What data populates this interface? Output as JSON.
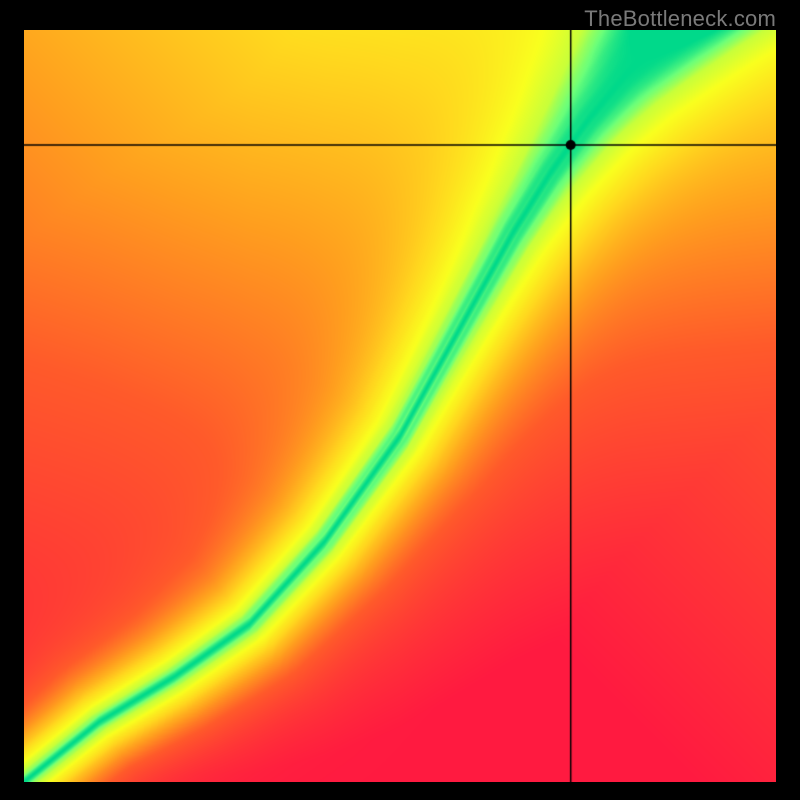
{
  "attribution": "TheBottleneck.com",
  "chart_data": {
    "type": "heatmap",
    "title": "",
    "xlabel": "",
    "ylabel": "",
    "xlim": [
      0,
      1
    ],
    "ylim": [
      0,
      1
    ],
    "crosshair": {
      "x": 0.727,
      "y": 0.847
    },
    "marker": {
      "x": 0.727,
      "y": 0.847
    },
    "ridge_curve": {
      "description": "locus of optimal (green) values, approximate",
      "points": [
        [
          0.0,
          0.0
        ],
        [
          0.1,
          0.08
        ],
        [
          0.2,
          0.14
        ],
        [
          0.3,
          0.21
        ],
        [
          0.4,
          0.32
        ],
        [
          0.5,
          0.46
        ],
        [
          0.55,
          0.55
        ],
        [
          0.6,
          0.64
        ],
        [
          0.65,
          0.73
        ],
        [
          0.7,
          0.81
        ],
        [
          0.75,
          0.88
        ],
        [
          0.8,
          0.94
        ],
        [
          0.85,
          0.99
        ]
      ]
    },
    "ridge_width": 0.055,
    "colorscale": {
      "stops": [
        {
          "t": 0.0,
          "color": "#ff1a40"
        },
        {
          "t": 0.35,
          "color": "#ff5a2a"
        },
        {
          "t": 0.55,
          "color": "#ff9f1e"
        },
        {
          "t": 0.72,
          "color": "#ffd81e"
        },
        {
          "t": 0.85,
          "color": "#f9ff1e"
        },
        {
          "t": 0.93,
          "color": "#c8ff3a"
        },
        {
          "t": 0.97,
          "color": "#6bff7a"
        },
        {
          "t": 1.0,
          "color": "#00d98a"
        }
      ]
    },
    "field_description": "Score falls off with distance from ridge and with distance from top-right corner"
  }
}
